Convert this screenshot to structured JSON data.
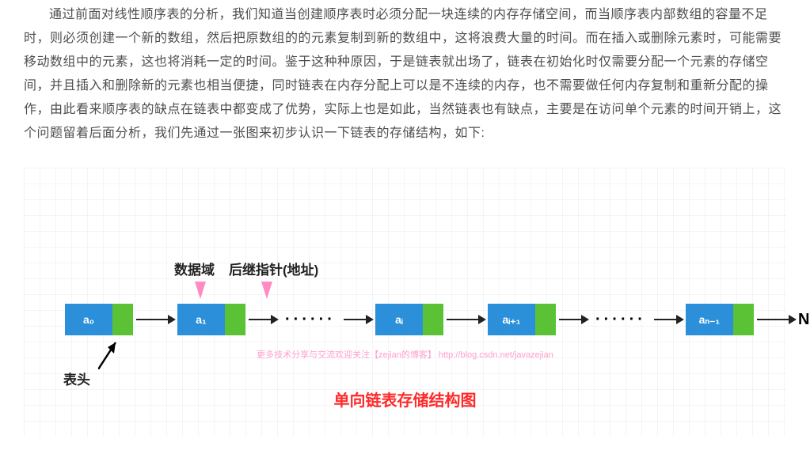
{
  "paragraph": "通过前面对线性顺序表的分析，我们知道当创建顺序表时必须分配一块连续的内存存储空间，而当顺序表内部数组的容量不足时，则必须创建一个新的数组，然后把原数组的的元素复制到新的数组中，这将浪费大量的时间。而在插入或删除元素时，可能需要移动数组中的元素，这也将消耗一定的时间。鉴于这种种原因，于是链表就出场了，链表在初始化时仅需要分配一个元素的存储空间，并且插入和删除新的元素也相当便捷，同时链表在内存分配上可以是不连续的内存，也不需要做任何内存复制和重新分配的操作，由此看来顺序表的缺点在链表中都变成了优势，实际上也是如此，当然链表也有缺点，主要是在访问单个元素的时间开销上，这个问题留着后面分析，我们先通过一张图来初步认识一下链表的存储结构，如下:",
  "diagram": {
    "label_data": "数据域",
    "label_ptr": "后继指针(地址)",
    "nodes": {
      "n0": "a₀",
      "n1": "a₁",
      "ni": "aᵢ",
      "ni1": "aᵢ₊₁",
      "nlast": "aₙ₋₁"
    },
    "dots": "······",
    "null": "NULL",
    "head": "表头",
    "watermark": "更多技术分享与交流欢迎关注【zejian的博客】 http://blog.csdn.net/javazejian",
    "title": "单向链表存储结构图"
  }
}
